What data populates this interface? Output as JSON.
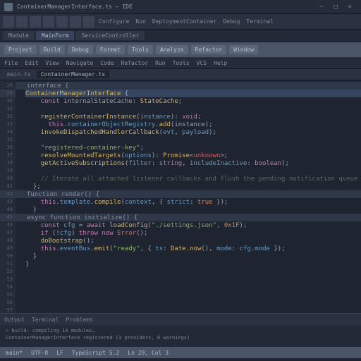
{
  "window": {
    "title": "ContainerManagerInterface.ts — IDE"
  },
  "toolbar": {
    "labels": [
      "Configure",
      "Run",
      "DeploymentContainer",
      "Debug",
      "Terminal"
    ]
  },
  "tabs1": [
    {
      "label": "Module",
      "active": false
    },
    {
      "label": "MainForm",
      "active": true
    },
    {
      "label": "ServiceController",
      "active": false
    }
  ],
  "ribbon": [
    "Project",
    "Build",
    "Debug",
    "Format",
    "Tools",
    "Analyze",
    "Refactor",
    "Window"
  ],
  "menubar": [
    "File",
    "Edit",
    "View",
    "Navigate",
    "Code",
    "Refactor",
    "Run",
    "Tools",
    "VCS",
    "Help"
  ],
  "tabs2": [
    {
      "label": "main.ts",
      "active": false
    },
    {
      "label": "ContainerManager.ts",
      "active": true
    }
  ],
  "gutter": {
    "start": 28,
    "count": 30,
    "marks": [
      1,
      14,
      17
    ]
  },
  "code": [
    {
      "cls": "sect",
      "tokens": [
        {
          "t": "interface {",
          "c": ""
        }
      ]
    },
    {
      "cls": "hl",
      "tokens": [
        {
          "t": "ContainerManagerInterface",
          "c": "fn"
        },
        {
          "t": " {",
          "c": ""
        }
      ]
    },
    {
      "tokens": [
        {
          "t": "    const ",
          "c": "kw"
        },
        {
          "t": "internalStateCache: ",
          "c": ""
        },
        {
          "t": "StateCache",
          "c": "fn"
        },
        {
          "t": ";",
          "c": ""
        }
      ]
    },
    {
      "tokens": [
        {
          "t": "",
          "c": ""
        }
      ]
    },
    {
      "tokens": [
        {
          "t": "    registerContainerInstance",
          "c": "fn"
        },
        {
          "t": "(",
          "c": ""
        },
        {
          "t": "instance",
          "c": "vr"
        },
        {
          "t": "): ",
          "c": ""
        },
        {
          "t": "void",
          "c": "kw"
        },
        {
          "t": ";",
          "c": ""
        }
      ]
    },
    {
      "tokens": [
        {
          "t": "      this",
          "c": "kw"
        },
        {
          "t": ".",
          "c": ""
        },
        {
          "t": "containerObjectRegistry",
          "c": "vr"
        },
        {
          "t": ".",
          "c": ""
        },
        {
          "t": "add",
          "c": "fn"
        },
        {
          "t": "(instance);",
          "c": ""
        }
      ]
    },
    {
      "tokens": [
        {
          "t": "    invokeDispatchedHandlerCallback",
          "c": "fn"
        },
        {
          "t": "(",
          "c": ""
        },
        {
          "t": "evt",
          "c": "vr"
        },
        {
          "t": ", ",
          "c": ""
        },
        {
          "t": "payload",
          "c": "vr"
        },
        {
          "t": ");",
          "c": ""
        }
      ]
    },
    {
      "tokens": [
        {
          "t": "",
          "c": ""
        }
      ]
    },
    {
      "tokens": [
        {
          "t": "    ",
          "c": ""
        },
        {
          "t": "\"registered-container-key\"",
          "c": "str"
        },
        {
          "t": ";",
          "c": ""
        }
      ]
    },
    {
      "tokens": [
        {
          "t": "    resolveMountedTargets",
          "c": "fn"
        },
        {
          "t": "(",
          "c": ""
        },
        {
          "t": "options",
          "c": "vr"
        },
        {
          "t": "): ",
          "c": ""
        },
        {
          "t": "Promise",
          "c": "fn"
        },
        {
          "t": "<",
          "c": ""
        },
        {
          "t": "unknown",
          "c": "er"
        },
        {
          "t": ">;",
          "c": ""
        }
      ]
    },
    {
      "tokens": [
        {
          "t": "    ",
          "c": ""
        },
        {
          "t": "getActiveSubscriptions",
          "c": "fn"
        },
        {
          "t": "(",
          "c": ""
        },
        {
          "t": "filter",
          "c": "vr"
        },
        {
          "t": ": ",
          "c": ""
        },
        {
          "t": "string",
          "c": "kw"
        },
        {
          "t": ", ",
          "c": ""
        },
        {
          "t": "includeInactive",
          "c": "vr"
        },
        {
          "t": ": ",
          "c": ""
        },
        {
          "t": "boolean",
          "c": "kw"
        },
        {
          "t": ");",
          "c": ""
        }
      ]
    },
    {
      "tokens": [
        {
          "t": "",
          "c": ""
        }
      ]
    },
    {
      "tokens": [
        {
          "t": "    ",
          "c": ""
        },
        {
          "t": "// Iterate all attached listener callbacks and flush the pending notification queue asynchronously",
          "c": "cm"
        }
      ]
    },
    {
      "tokens": [
        {
          "t": "  };",
          "c": ""
        }
      ]
    },
    {
      "cls": "sect",
      "tokens": [
        {
          "t": "function render() {",
          "c": ""
        }
      ]
    },
    {
      "tokens": [
        {
          "t": "    ",
          "c": ""
        },
        {
          "t": "this",
          "c": "kw"
        },
        {
          "t": ".",
          "c": ""
        },
        {
          "t": "template",
          "c": "vr"
        },
        {
          "t": ".",
          "c": ""
        },
        {
          "t": "compile",
          "c": "fn"
        },
        {
          "t": "(",
          "c": ""
        },
        {
          "t": "context",
          "c": "vr"
        },
        {
          "t": ", { ",
          "c": ""
        },
        {
          "t": "strict",
          "c": "vr"
        },
        {
          "t": ": ",
          "c": ""
        },
        {
          "t": "true",
          "c": "num"
        },
        {
          "t": " });",
          "c": ""
        }
      ]
    },
    {
      "tokens": [
        {
          "t": "  }",
          "c": ""
        }
      ]
    },
    {
      "cls": "sect",
      "tokens": [
        {
          "t": "async function initialize() {",
          "c": ""
        }
      ]
    },
    {
      "tokens": [
        {
          "t": "    ",
          "c": ""
        },
        {
          "t": "const ",
          "c": "kw"
        },
        {
          "t": "cfg",
          "c": "vr"
        },
        {
          "t": " = ",
          "c": ""
        },
        {
          "t": "await ",
          "c": "kw"
        },
        {
          "t": "loadConfig",
          "c": "fn"
        },
        {
          "t": "(",
          "c": ""
        },
        {
          "t": "\"./settings.json\"",
          "c": "str"
        },
        {
          "t": ", ",
          "c": ""
        },
        {
          "t": "0x1F",
          "c": "num"
        },
        {
          "t": ");",
          "c": ""
        }
      ]
    },
    {
      "tokens": [
        {
          "t": "    ",
          "c": ""
        },
        {
          "t": "if",
          "c": "kw"
        },
        {
          "t": " (!",
          "c": ""
        },
        {
          "t": "cfg",
          "c": "vr"
        },
        {
          "t": ") ",
          "c": ""
        },
        {
          "t": "throw ",
          "c": "kw"
        },
        {
          "t": "new ",
          "c": "kw"
        },
        {
          "t": "Error",
          "c": "er"
        },
        {
          "t": "();",
          "c": ""
        }
      ]
    },
    {
      "tokens": [
        {
          "t": "    ",
          "c": ""
        },
        {
          "t": "doBootstrap",
          "c": "fn"
        },
        {
          "t": "();",
          "c": ""
        }
      ]
    },
    {
      "tokens": [
        {
          "t": "    ",
          "c": ""
        },
        {
          "t": "this",
          "c": "kw"
        },
        {
          "t": ".",
          "c": ""
        },
        {
          "t": "eventBus",
          "c": "vr"
        },
        {
          "t": ".",
          "c": ""
        },
        {
          "t": "emit",
          "c": "fn"
        },
        {
          "t": "(",
          "c": ""
        },
        {
          "t": "\"ready\"",
          "c": "str"
        },
        {
          "t": ", { ",
          "c": ""
        },
        {
          "t": "ts",
          "c": "vr"
        },
        {
          "t": ": ",
          "c": ""
        },
        {
          "t": "Date",
          "c": "fn"
        },
        {
          "t": ".",
          "c": ""
        },
        {
          "t": "now",
          "c": "fn"
        },
        {
          "t": "(), ",
          "c": ""
        },
        {
          "t": "mode",
          "c": "vr"
        },
        {
          "t": ": ",
          "c": ""
        },
        {
          "t": "cfg",
          "c": "vr"
        },
        {
          "t": ".",
          "c": ""
        },
        {
          "t": "mode",
          "c": "vr"
        },
        {
          "t": " });",
          "c": ""
        }
      ]
    },
    {
      "tokens": [
        {
          "t": "  }",
          "c": ""
        }
      ]
    },
    {
      "tokens": [
        {
          "t": "}",
          "c": ""
        }
      ]
    },
    {
      "tokens": [
        {
          "t": "",
          "c": ""
        }
      ]
    },
    {
      "tokens": [
        {
          "t": "",
          "c": ""
        }
      ]
    },
    {
      "tokens": [
        {
          "t": "",
          "c": ""
        }
      ]
    },
    {
      "tokens": [
        {
          "t": "",
          "c": ""
        }
      ]
    },
    {
      "tokens": [
        {
          "t": "",
          "c": ""
        }
      ]
    },
    {
      "tokens": [
        {
          "t": "",
          "c": ""
        }
      ]
    }
  ],
  "panel": {
    "tabs": [
      "Output",
      "Terminal",
      "Problems"
    ],
    "lines": [
      "> build: compiling 14 modules…",
      "  ContainerManagerInterface registered (3 providers, 0 warnings)"
    ]
  },
  "status": [
    "main*",
    "UTF-8",
    "LF",
    "TypeScript 5.2",
    "Ln 29, Col 3"
  ]
}
